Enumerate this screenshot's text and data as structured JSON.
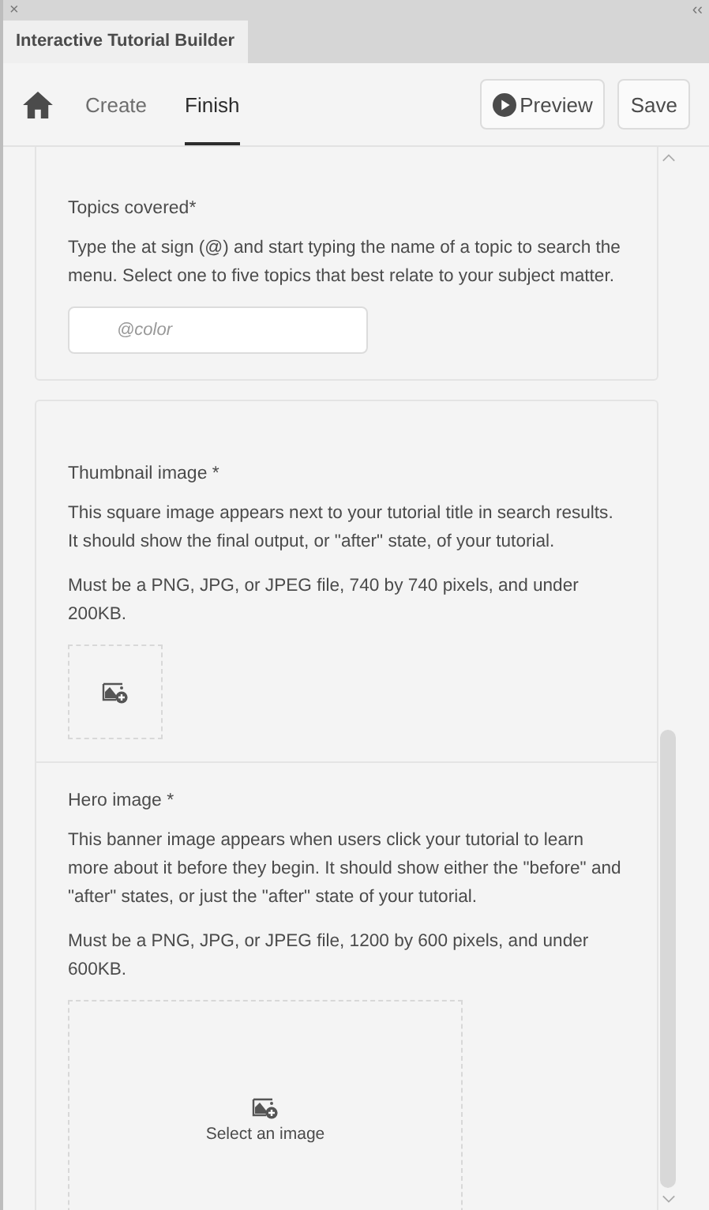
{
  "panel": {
    "close": "×",
    "collapse": "‹‹",
    "title": "Interactive Tutorial Builder"
  },
  "nav": {
    "tabs": [
      {
        "label": "Create",
        "selected": false
      },
      {
        "label": "Finish",
        "selected": true
      }
    ],
    "buttons": [
      {
        "label": "Preview",
        "kind": "play"
      },
      {
        "label": "Save",
        "kind": "plain"
      }
    ]
  },
  "sections": [
    {
      "kind": "topics",
      "label": "Topics covered*",
      "help": [
        "Type the at sign (@) and start typing the name of a topic to search the menu. Select one to five topics that best relate to your subject matter."
      ],
      "placeholder": "@color"
    },
    {
      "kind": "thumbnail",
      "label": "Thumbnail image *",
      "help": [
        "This square image appears next to your tutorial title in search results. It should show the final output, or \"after\" state, of your tutorial.",
        "Must be a PNG, JPG, or JPEG file, 740 by 740 pixels, and under 200KB."
      ]
    },
    {
      "kind": "hero",
      "label": "Hero image *",
      "help": [
        "This banner image appears when users click your tutorial to learn more about it before they begin. It should show either the \"before\" and \"after\" states, or just the \"after\" state of your tutorial.",
        "Must be a PNG, JPG, or JPEG file, 1200 by 600 pixels, and under 600KB."
      ],
      "action": "Select an image"
    }
  ]
}
